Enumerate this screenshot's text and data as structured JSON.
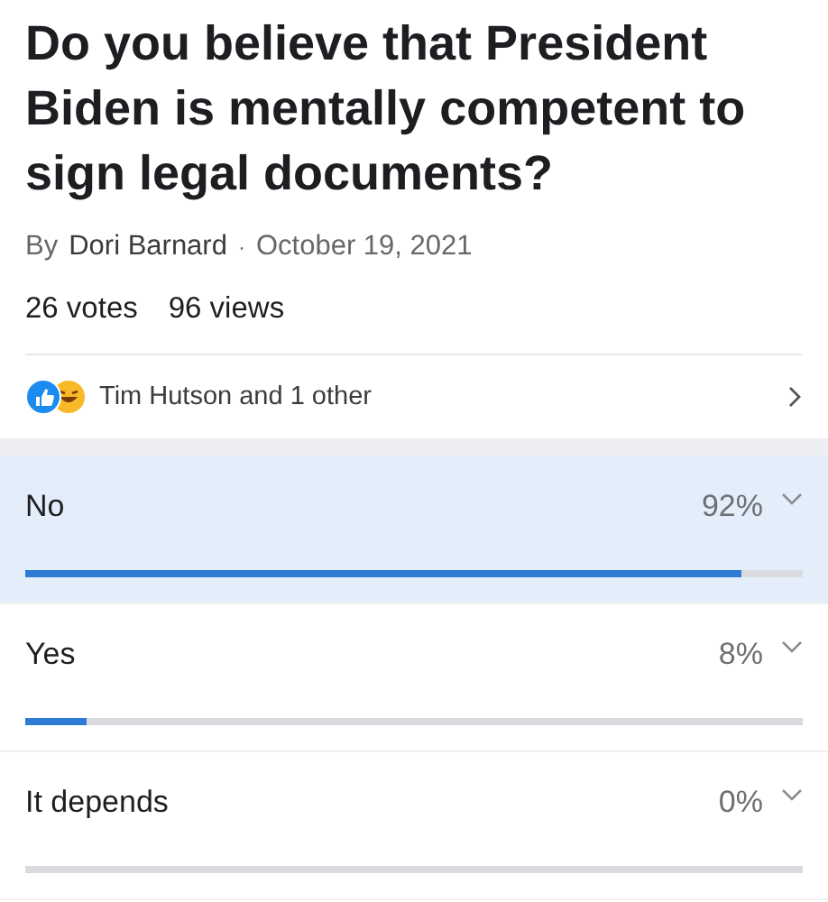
{
  "poll": {
    "question": "Do you believe that President Biden is mentally competent to sign legal documents?",
    "byline_prefix": "By",
    "author": "Dori Barnard",
    "separator": "·",
    "date": "October 19, 2021",
    "votes": "26 votes",
    "views": "96 views"
  },
  "reactions": {
    "text": "Tim Hutson and 1 other"
  },
  "options": [
    {
      "label": "No",
      "percent": "92%",
      "level": 0.92,
      "selected": true
    },
    {
      "label": "Yes",
      "percent": "8%",
      "level": 0.08,
      "selected": false
    },
    {
      "label": "It depends",
      "percent": "0%",
      "level": 0,
      "selected": false
    }
  ]
}
